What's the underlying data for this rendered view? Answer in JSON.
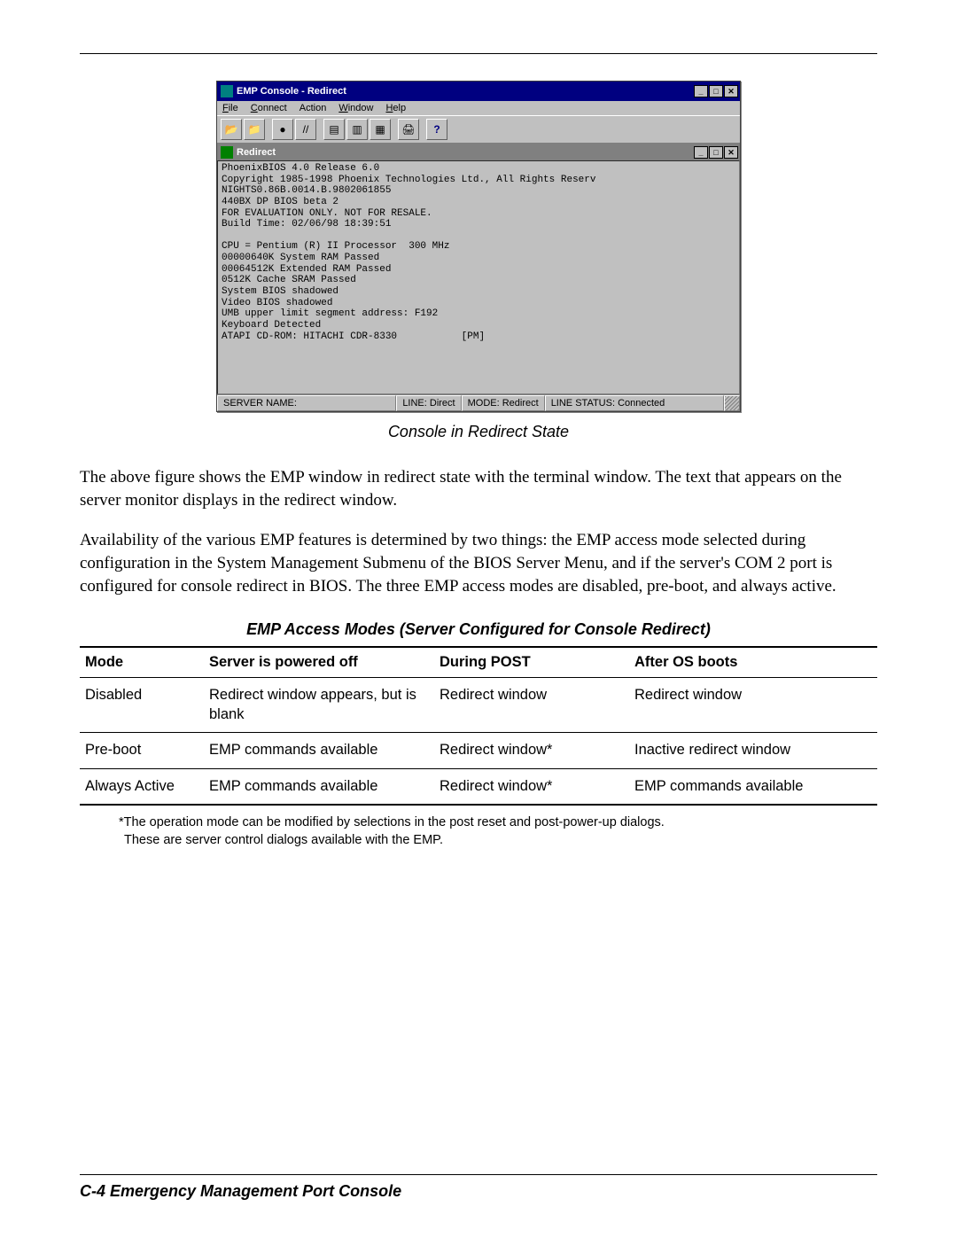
{
  "window": {
    "title": "EMP Console - Redirect",
    "menus": {
      "file": "File",
      "file_u": "F",
      "connect": "Connect",
      "connect_u": "C",
      "action": "Action",
      "window": "Window",
      "window_u": "W",
      "help": "Help",
      "help_u": "H"
    },
    "win_controls": {
      "min": "_",
      "max": "□",
      "close": "✕"
    },
    "toolbar_icons": {
      "i1": "📂",
      "i2": "📁",
      "i3": "●",
      "i4": "//",
      "i5": "▤",
      "i6": "▥",
      "i7": "▦",
      "i8": "🖨",
      "i9": "?"
    },
    "subwindow": {
      "title": "Redirect",
      "terminal_lines": "PhoenixBIOS 4.0 Release 6.0\nCopyright 1985-1998 Phoenix Technologies Ltd., All Rights Reserv\nNIGHTS0.86B.0014.B.9802061855\n440BX DP BIOS beta 2\nFOR EVALUATION ONLY. NOT FOR RESALE.\nBuild Time: 02/06/98 18:39:51\n\nCPU = Pentium (R) II Processor  300 MHz\n00000640K System RAM Passed\n00064512K Extended RAM Passed\n0512K Cache SRAM Passed\nSystem BIOS shadowed\nVideo BIOS shadowed\nUMB upper limit segment address: F192\nKeyboard Detected\nATAPI CD-ROM: HITACHI CDR-8330           [PM]"
    },
    "statusbar": {
      "server_name_label": "SERVER NAME:",
      "line_label": "LINE: Direct",
      "mode_label": "MODE: Redirect",
      "line_status_label": "LINE STATUS: Connected"
    }
  },
  "figure_caption": "Console in Redirect State",
  "para1": "The above figure shows the EMP window in redirect state with the terminal window. The text that appears on the server monitor displays in the redirect window.",
  "para2": "Availability of the various EMP features is determined by two things: the EMP access mode selected during configuration in the System Management Submenu of the BIOS Server Menu, and if the server's COM 2 port is configured for console redirect in BIOS. The three EMP access modes are disabled, pre-boot, and always active.",
  "table_caption": "EMP Access Modes (Server Configured for Console Redirect)",
  "table": {
    "headers": {
      "h1": "Mode",
      "h2": "Server is powered off",
      "h3": "During POST",
      "h4": "After OS boots"
    },
    "rows": [
      {
        "c1": "Disabled",
        "c2": "Redirect window appears, but is blank",
        "c3": "Redirect window",
        "c4": "Redirect window"
      },
      {
        "c1": "Pre-boot",
        "c2": "EMP commands available",
        "c3": "Redirect window*",
        "c4": "Inactive redirect window"
      },
      {
        "c1": "Always Active",
        "c2": "EMP commands available",
        "c3": "Redirect window*",
        "c4": "EMP commands available"
      }
    ]
  },
  "footnote_l1": "*The operation mode can be modified by selections in the post reset and post-power-up dialogs.",
  "footnote_l2": " These are server control dialogs available with the EMP.",
  "footer": "C-4   Emergency Management Port Console"
}
